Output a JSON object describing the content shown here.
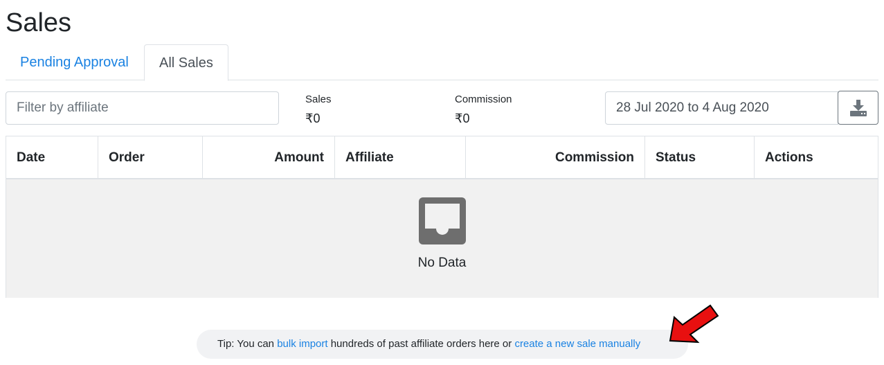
{
  "page": {
    "title": "Sales"
  },
  "tabs": [
    {
      "label": "Pending Approval",
      "active": false
    },
    {
      "label": "All Sales",
      "active": true
    }
  ],
  "filter": {
    "placeholder": "Filter by affiliate",
    "value": ""
  },
  "stats": {
    "sales": {
      "label": "Sales",
      "value": "₹0"
    },
    "commission": {
      "label": "Commission",
      "value": "₹0"
    }
  },
  "date_range": {
    "value": "28 Jul 2020 to 4 Aug 2020"
  },
  "download": {
    "icon": "download-icon"
  },
  "table": {
    "columns": [
      "Date",
      "Order",
      "Amount",
      "Affiliate",
      "Commission",
      "Status",
      "Actions"
    ],
    "rows": [],
    "empty": {
      "icon": "inbox-icon",
      "text": "No Data"
    }
  },
  "tip": {
    "prefix": "Tip: You can ",
    "link1": "bulk import",
    "middle": " hundreds of past affiliate orders here or ",
    "link2": "create a new sale manually"
  },
  "colors": {
    "link": "#1a82e2",
    "empty_bg": "#f1f1f1",
    "tip_bg": "#f1f2f4",
    "annotation_arrow": "#e81010"
  }
}
